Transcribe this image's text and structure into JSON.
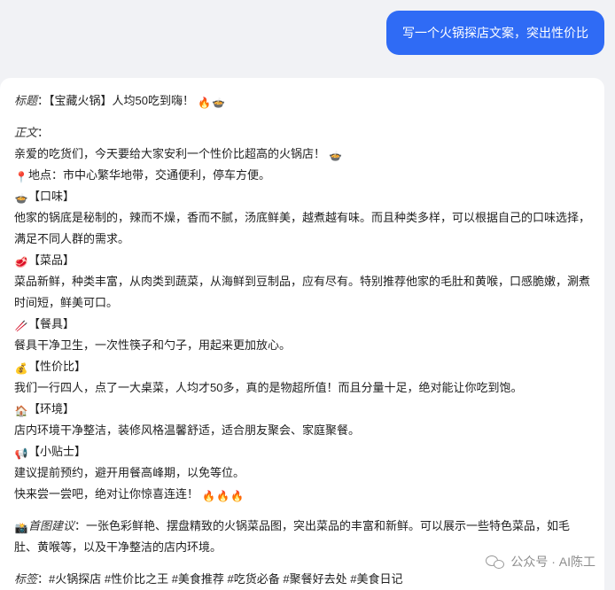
{
  "user_message": {
    "text": "写一个火锅探店文案，突出性价比"
  },
  "answer": {
    "title_label": "标题",
    "title_text": "：【宝藏火锅】人均50吃到嗨！",
    "body_label": "正文",
    "colon": "：",
    "intro": "亲爱的吃货们，今天要给大家安利一个性价比超高的火锅店！",
    "location": "地点：市中心繁华地带，交通便利，停车方便。",
    "taste_heading": "【口味】",
    "taste_text": "他家的锅底是秘制的，辣而不燥，香而不腻，汤底鲜美，越煮越有味。而且种类多样，可以根据自己的口味选择，满足不同人群的需求。",
    "dishes_heading": "【菜品】",
    "dishes_text": "菜品新鲜，种类丰富，从肉类到蔬菜，从海鲜到豆制品，应有尽有。特别推荐他家的毛肚和黄喉，口感脆嫩，涮煮时间短，鲜美可口。",
    "tableware_heading": "【餐具】",
    "tableware_text": "餐具干净卫生，一次性筷子和勺子，用起来更加放心。",
    "value_heading": "【性价比】",
    "value_text": "我们一行四人，点了一大桌菜，人均才50多，真的是物超所值！而且分量十足，绝对能让你吃到饱。",
    "env_heading": "【环境】",
    "env_text": "店内环境干净整洁，装修风格温馨舒适，适合朋友聚会、家庭聚餐。",
    "tips_heading": "【小贴士】",
    "tips_text": "建议提前预约，避开用餐高峰期，以免等位。",
    "closing": "快来尝一尝吧，绝对让你惊喜连连！",
    "image_label": "首图建议",
    "image_text": "：一张色彩鲜艳、摆盘精致的火锅菜品图，突出菜品的丰富和新鲜。可以展示一些特色菜品，如毛肚、黄喉等，以及干净整洁的店内环境。",
    "tags_label": "标签",
    "tags_text": "：#火锅探店 #性价比之王 #美食推荐 #吃货必备 #聚餐好去处 #美食日记"
  },
  "icons": {
    "fire": "fire-icon",
    "pin": "pin-icon",
    "bowl": "hotpot-bowl-icon",
    "meat": "meat-icon",
    "chopsticks": "chopsticks-icon",
    "money": "money-bag-icon",
    "house": "house-icon",
    "flag": "flag-icon",
    "camera": "camera-icon"
  },
  "watermark": {
    "text": "公众号 · AI陈工"
  },
  "colors": {
    "user_bubble": "#2f6bf5",
    "card": "#ffffff",
    "background": "#f1f2f5"
  }
}
